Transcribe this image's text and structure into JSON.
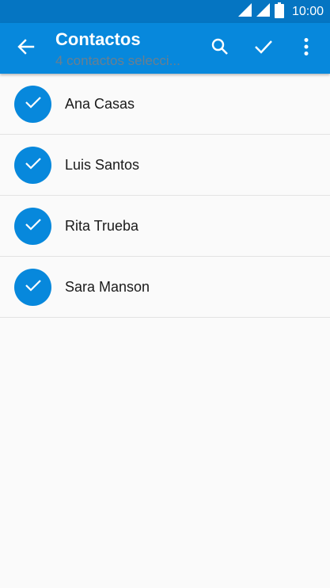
{
  "status_bar": {
    "time": "10:00",
    "icons": [
      "signal-icon",
      "signal-icon",
      "battery-icon"
    ]
  },
  "app_bar": {
    "title": "Contactos",
    "subtitle": "4 contactos selecci...",
    "actions": [
      "back-arrow-icon",
      "search-icon",
      "check-icon",
      "more-vert-icon"
    ]
  },
  "contacts": [
    {
      "name": "Ana Casas",
      "selected": true
    },
    {
      "name": "Luis Santos",
      "selected": true
    },
    {
      "name": "Rita Trueba",
      "selected": true
    },
    {
      "name": "Sara Manson",
      "selected": true
    }
  ],
  "colors": {
    "status_bar": "#0575c2",
    "app_bar": "#0788dc",
    "accent": "#0788dc",
    "background": "#fafafa"
  }
}
